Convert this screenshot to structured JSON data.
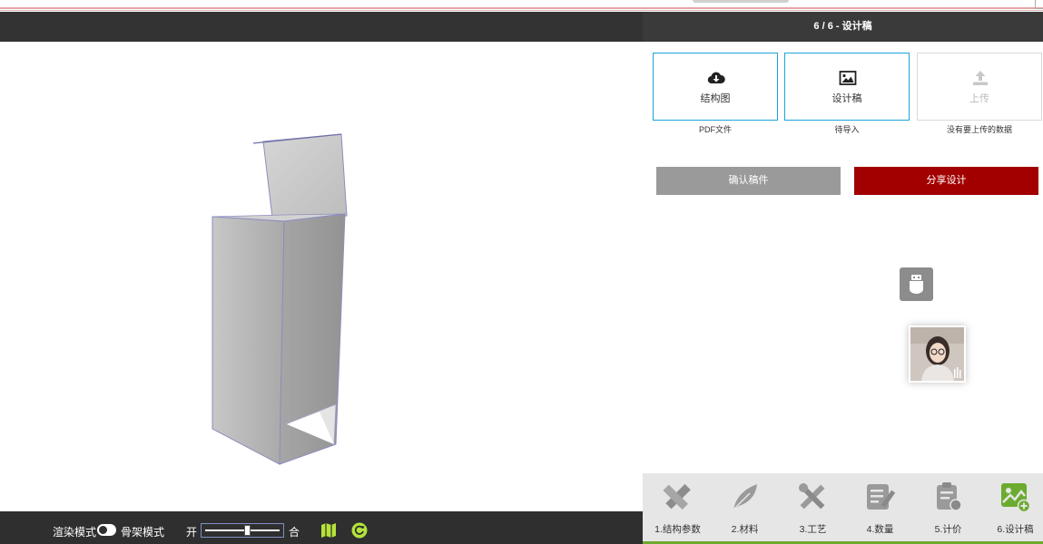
{
  "right_panel": {
    "title": "6 / 6 - 设计稿",
    "file_cards": [
      {
        "label": "结构图",
        "sub": "PDF文件",
        "icon": "cloud-download-icon"
      },
      {
        "label": "设计稿",
        "sub": "待导入",
        "icon": "image-icon"
      },
      {
        "label": "上传",
        "sub": "没有要上传的数据",
        "icon": "upload-icon"
      }
    ],
    "confirm_button": "确认稿件",
    "share_button": "分享设计"
  },
  "bottom_toolbar": {
    "render_mode_label": "渲染模式",
    "skeleton_mode_label": "骨架模式",
    "open_label": "开",
    "close_label": "合",
    "fold_level": 0.57
  },
  "steps": [
    {
      "label": "1.结构参数",
      "icon": "ruler-pencil-icon"
    },
    {
      "label": "2.材料",
      "icon": "feather-icon"
    },
    {
      "label": "3.工艺",
      "icon": "tools-icon"
    },
    {
      "label": "4.数量",
      "icon": "edit-list-icon"
    },
    {
      "label": "5.计价",
      "icon": "price-clipboard-icon"
    },
    {
      "label": "6.设计稿",
      "icon": "design-image-icon",
      "active": true
    }
  ],
  "colors": {
    "accent_red": "#a20000",
    "link_blue": "#1aa3d9",
    "active_green": "#6cab2f",
    "dark_bar": "#333333"
  }
}
